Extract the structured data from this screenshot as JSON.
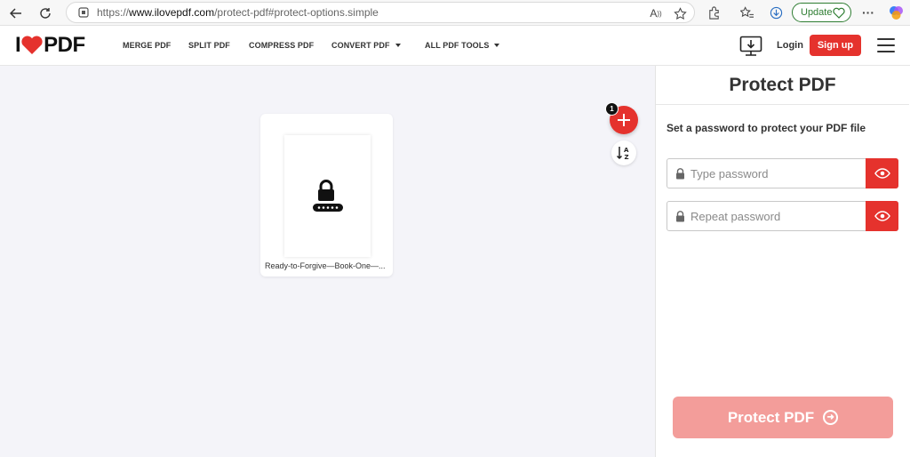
{
  "browser": {
    "url_prefix": "https://",
    "url_domain": "www.ilovepdf.com",
    "url_path": "/protect-pdf#protect-options.simple",
    "update_label": "Update"
  },
  "header": {
    "logo_left": "I",
    "logo_right": "PDF",
    "nav": [
      {
        "label": "MERGE PDF"
      },
      {
        "label": "SPLIT PDF"
      },
      {
        "label": "COMPRESS PDF"
      },
      {
        "label": "CONVERT PDF"
      },
      {
        "label": "ALL PDF TOOLS"
      }
    ],
    "login_label": "Login",
    "signup_label": "Sign up"
  },
  "workspace": {
    "file_name": "Ready-to-Forgive—Book-One—...",
    "file_count": "1",
    "add_icon": "plus-icon",
    "sort_icon": "sort-az-icon"
  },
  "sidebar": {
    "title": "Protect PDF",
    "instruction": "Set a password to protect your PDF file",
    "password_placeholder": "Type password",
    "repeat_placeholder": "Repeat password",
    "submit_label": "Protect PDF"
  },
  "colors": {
    "brand_red": "#e5322d",
    "disabled_red": "#f39d9a"
  }
}
